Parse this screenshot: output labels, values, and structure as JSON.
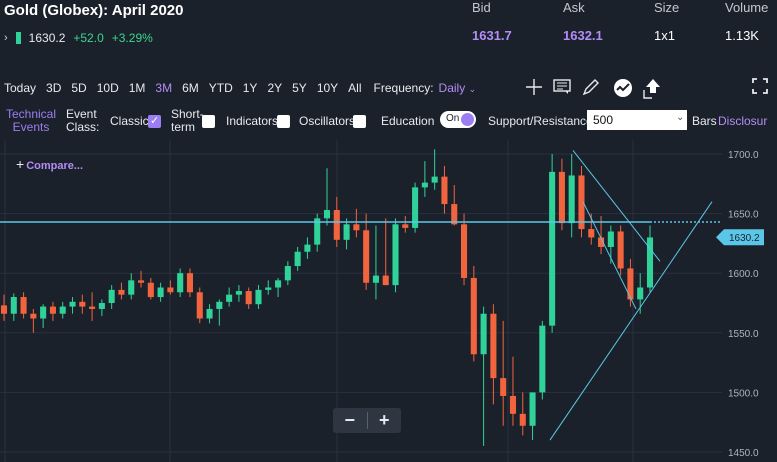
{
  "header": {
    "title": "Gold (Globex): April 2020",
    "price": "1630.2",
    "change": "+52.0",
    "change_pct": "+3.29%",
    "bid_label": "Bid",
    "bid_value": "1631.7",
    "ask_label": "Ask",
    "ask_value": "1632.1",
    "size_label": "Size",
    "size_value": "1x1",
    "volume_label": "Volume",
    "volume_value": "1.13K"
  },
  "timeframes": [
    "Today",
    "3D",
    "5D",
    "10D",
    "1M",
    "3M",
    "6M",
    "YTD",
    "1Y",
    "2Y",
    "5Y",
    "10Y",
    "All"
  ],
  "active_timeframe": "3M",
  "frequency": {
    "label": "Frequency:",
    "value": "Daily"
  },
  "options": {
    "technical_events": "Technical Events",
    "event_class": "Event Class:",
    "classic": "Classic",
    "short_term": "Short-term",
    "indicators": "Indicators",
    "oscillators": "Oscillators",
    "education": "Education",
    "toggle": "On",
    "support_resistance": "Support/Resistance",
    "sr_value": "500",
    "bars": "Bars",
    "disclosure": "Disclosur"
  },
  "compare": "Compare...",
  "zoom": {
    "minus": "−",
    "plus": "+"
  },
  "colors": {
    "up": "#2fd39a",
    "down": "#f2643d",
    "accent": "#b48cf5",
    "line": "#5bc7e8"
  },
  "chart_data": {
    "type": "candlestick",
    "y_ticks": [
      "1700.0",
      "1650.0",
      "1600.0",
      "1550.0",
      "1500.0",
      "1450.0"
    ],
    "y_range": [
      1450,
      1700
    ],
    "last_price_label": "1630.2",
    "price_line": 1643,
    "candles": [
      {
        "o": 1573,
        "h": 1582,
        "l": 1560,
        "c": 1566
      },
      {
        "o": 1566,
        "h": 1583,
        "l": 1560,
        "c": 1580
      },
      {
        "o": 1580,
        "h": 1584,
        "l": 1562,
        "c": 1566
      },
      {
        "o": 1566,
        "h": 1570,
        "l": 1550,
        "c": 1562
      },
      {
        "o": 1562,
        "h": 1574,
        "l": 1554,
        "c": 1572
      },
      {
        "o": 1572,
        "h": 1576,
        "l": 1560,
        "c": 1566
      },
      {
        "o": 1566,
        "h": 1576,
        "l": 1562,
        "c": 1572
      },
      {
        "o": 1572,
        "h": 1580,
        "l": 1566,
        "c": 1576
      },
      {
        "o": 1576,
        "h": 1582,
        "l": 1566,
        "c": 1572
      },
      {
        "o": 1572,
        "h": 1584,
        "l": 1560,
        "c": 1570
      },
      {
        "o": 1570,
        "h": 1578,
        "l": 1564,
        "c": 1575
      },
      {
        "o": 1575,
        "h": 1590,
        "l": 1570,
        "c": 1586
      },
      {
        "o": 1586,
        "h": 1592,
        "l": 1578,
        "c": 1582
      },
      {
        "o": 1582,
        "h": 1600,
        "l": 1578,
        "c": 1594
      },
      {
        "o": 1594,
        "h": 1602,
        "l": 1588,
        "c": 1592
      },
      {
        "o": 1592,
        "h": 1596,
        "l": 1578,
        "c": 1580
      },
      {
        "o": 1580,
        "h": 1592,
        "l": 1576,
        "c": 1588
      },
      {
        "o": 1588,
        "h": 1594,
        "l": 1582,
        "c": 1584
      },
      {
        "o": 1584,
        "h": 1604,
        "l": 1580,
        "c": 1600
      },
      {
        "o": 1600,
        "h": 1604,
        "l": 1580,
        "c": 1584
      },
      {
        "o": 1584,
        "h": 1588,
        "l": 1558,
        "c": 1562
      },
      {
        "o": 1562,
        "h": 1574,
        "l": 1558,
        "c": 1570
      },
      {
        "o": 1570,
        "h": 1578,
        "l": 1556,
        "c": 1576
      },
      {
        "o": 1576,
        "h": 1588,
        "l": 1572,
        "c": 1582
      },
      {
        "o": 1582,
        "h": 1590,
        "l": 1576,
        "c": 1585
      },
      {
        "o": 1585,
        "h": 1588,
        "l": 1570,
        "c": 1574
      },
      {
        "o": 1574,
        "h": 1590,
        "l": 1570,
        "c": 1586
      },
      {
        "o": 1586,
        "h": 1594,
        "l": 1582,
        "c": 1588
      },
      {
        "o": 1588,
        "h": 1596,
        "l": 1580,
        "c": 1594
      },
      {
        "o": 1594,
        "h": 1610,
        "l": 1590,
        "c": 1606
      },
      {
        "o": 1606,
        "h": 1622,
        "l": 1602,
        "c": 1618
      },
      {
        "o": 1618,
        "h": 1630,
        "l": 1612,
        "c": 1624
      },
      {
        "o": 1624,
        "h": 1650,
        "l": 1618,
        "c": 1646
      },
      {
        "o": 1646,
        "h": 1688,
        "l": 1640,
        "c": 1653
      },
      {
        "o": 1653,
        "h": 1664,
        "l": 1622,
        "c": 1628
      },
      {
        "o": 1628,
        "h": 1646,
        "l": 1620,
        "c": 1641
      },
      {
        "o": 1641,
        "h": 1654,
        "l": 1630,
        "c": 1636
      },
      {
        "o": 1636,
        "h": 1650,
        "l": 1586,
        "c": 1592
      },
      {
        "o": 1592,
        "h": 1640,
        "l": 1578,
        "c": 1598
      },
      {
        "o": 1598,
        "h": 1646,
        "l": 1590,
        "c": 1590
      },
      {
        "o": 1590,
        "h": 1646,
        "l": 1584,
        "c": 1641
      },
      {
        "o": 1641,
        "h": 1648,
        "l": 1634,
        "c": 1638
      },
      {
        "o": 1638,
        "h": 1676,
        "l": 1634,
        "c": 1672
      },
      {
        "o": 1672,
        "h": 1694,
        "l": 1664,
        "c": 1676
      },
      {
        "o": 1676,
        "h": 1704,
        "l": 1670,
        "c": 1681
      },
      {
        "o": 1681,
        "h": 1690,
        "l": 1650,
        "c": 1658
      },
      {
        "o": 1658,
        "h": 1674,
        "l": 1640,
        "c": 1641
      },
      {
        "o": 1641,
        "h": 1650,
        "l": 1590,
        "c": 1596
      },
      {
        "o": 1596,
        "h": 1606,
        "l": 1526,
        "c": 1532
      },
      {
        "o": 1532,
        "h": 1572,
        "l": 1455,
        "c": 1566
      },
      {
        "o": 1566,
        "h": 1574,
        "l": 1490,
        "c": 1512
      },
      {
        "o": 1512,
        "h": 1560,
        "l": 1472,
        "c": 1497
      },
      {
        "o": 1497,
        "h": 1530,
        "l": 1472,
        "c": 1482
      },
      {
        "o": 1482,
        "h": 1500,
        "l": 1464,
        "c": 1472
      },
      {
        "o": 1472,
        "h": 1500,
        "l": 1460,
        "c": 1500
      },
      {
        "o": 1500,
        "h": 1560,
        "l": 1494,
        "c": 1556
      },
      {
        "o": 1556,
        "h": 1700,
        "l": 1550,
        "c": 1685
      },
      {
        "o": 1685,
        "h": 1696,
        "l": 1636,
        "c": 1642
      },
      {
        "o": 1642,
        "h": 1700,
        "l": 1630,
        "c": 1682
      },
      {
        "o": 1682,
        "h": 1690,
        "l": 1630,
        "c": 1637
      },
      {
        "o": 1637,
        "h": 1650,
        "l": 1624,
        "c": 1630
      },
      {
        "o": 1630,
        "h": 1648,
        "l": 1616,
        "c": 1622
      },
      {
        "o": 1622,
        "h": 1640,
        "l": 1608,
        "c": 1635
      },
      {
        "o": 1635,
        "h": 1640,
        "l": 1598,
        "c": 1604
      },
      {
        "o": 1604,
        "h": 1612,
        "l": 1572,
        "c": 1578
      },
      {
        "o": 1578,
        "h": 1600,
        "l": 1566,
        "c": 1588
      },
      {
        "o": 1588,
        "h": 1640,
        "l": 1584,
        "c": 1630
      }
    ]
  }
}
